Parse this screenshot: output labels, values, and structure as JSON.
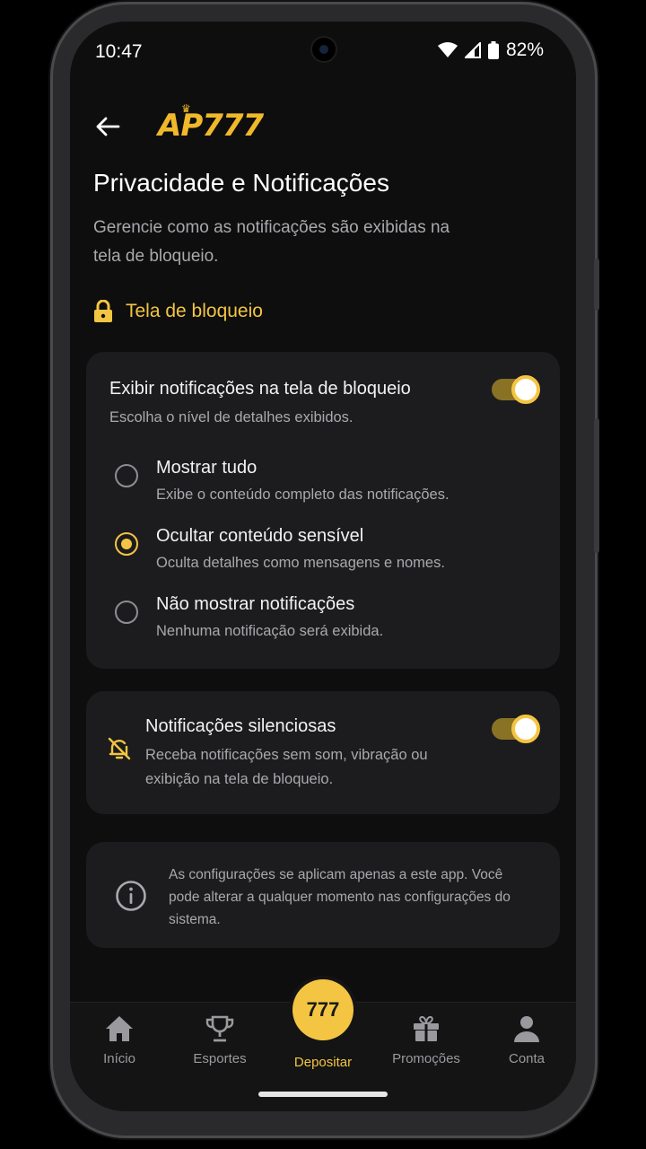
{
  "status_bar": {
    "time": "10:47",
    "battery": "82%"
  },
  "header": {
    "logo_text": "AP777"
  },
  "page": {
    "title": "Privacidade e Notificações",
    "subtitle": "Gerencie como as notificações são exibidas na tela de bloqueio."
  },
  "section": {
    "title": "Tela de bloqueio"
  },
  "lockscreen_card": {
    "title": "Exibir notificações na tela de bloqueio",
    "subtitle": "Escolha o nível de detalhes exibidos.",
    "toggle_on": true,
    "options": [
      {
        "label": "Mostrar tudo",
        "desc": "Exibe o conteúdo completo das notificações.",
        "selected": false
      },
      {
        "label": "Ocultar conteúdo sensível",
        "desc": "Oculta detalhes como mensagens e nomes.",
        "selected": true
      },
      {
        "label": "Não mostrar notificações",
        "desc": "Nenhuma notificação será exibida.",
        "selected": false
      }
    ]
  },
  "silent_card": {
    "title": "Notificações silenciosas",
    "subtitle": "Receba notificações sem som, vibração ou exibição na tela de bloqueio.",
    "toggle_on": true
  },
  "info_card": {
    "text": "As configurações se aplicam apenas a este app. Você pode alterar a qualquer momento nas configurações do sistema."
  },
  "bottom_nav": {
    "items": [
      {
        "label": "Início"
      },
      {
        "label": "Esportes"
      },
      {
        "label": "Depositar",
        "badge": "777"
      },
      {
        "label": "Promoções"
      },
      {
        "label": "Conta"
      }
    ]
  },
  "colors": {
    "accent": "#f4c542",
    "background": "#0e0e0f",
    "card": "#1c1c1e"
  }
}
